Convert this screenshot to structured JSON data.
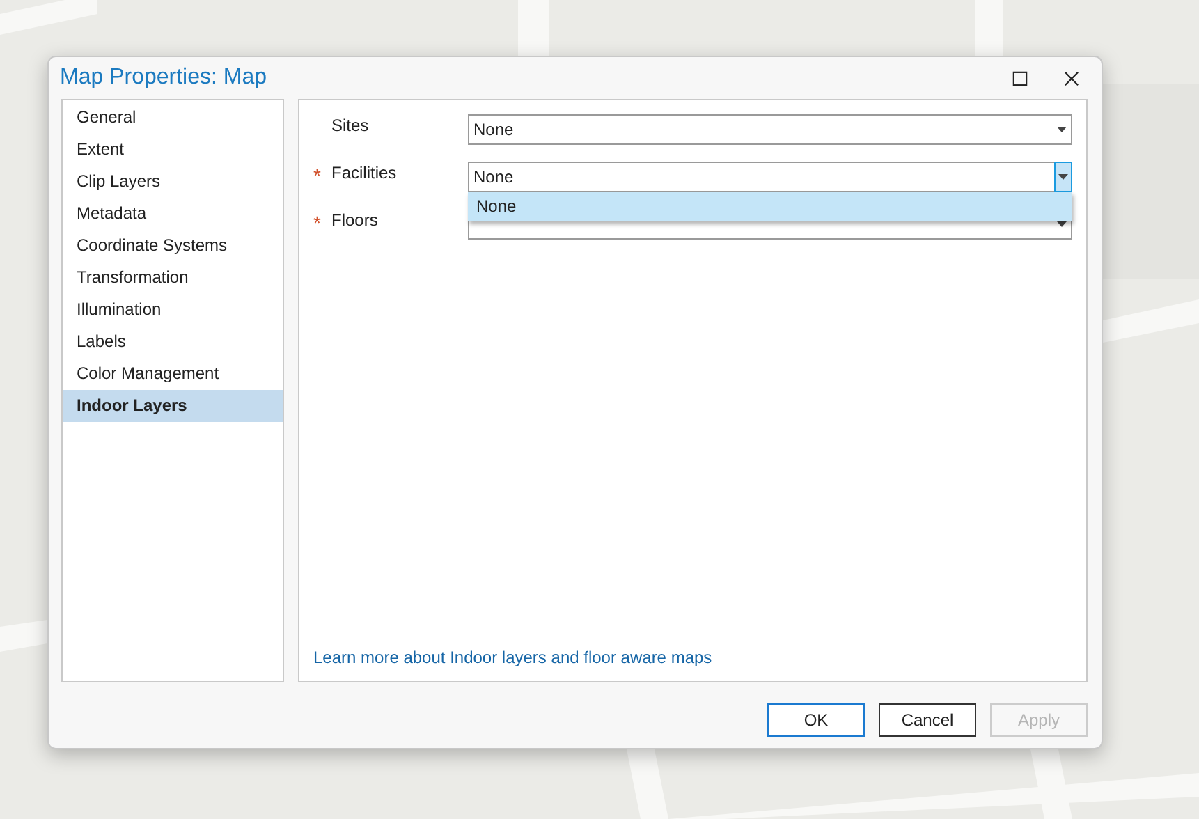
{
  "window": {
    "title": "Map Properties: Map"
  },
  "sidebar": {
    "items": [
      {
        "label": "General",
        "selected": false
      },
      {
        "label": "Extent",
        "selected": false
      },
      {
        "label": "Clip Layers",
        "selected": false
      },
      {
        "label": "Metadata",
        "selected": false
      },
      {
        "label": "Coordinate Systems",
        "selected": false
      },
      {
        "label": "Transformation",
        "selected": false
      },
      {
        "label": "Illumination",
        "selected": false
      },
      {
        "label": "Labels",
        "selected": false
      },
      {
        "label": "Color Management",
        "selected": false
      },
      {
        "label": "Indoor Layers",
        "selected": true
      }
    ]
  },
  "fields": [
    {
      "label": "Sites",
      "value": "None",
      "open": false
    },
    {
      "mark": "*",
      "label": "Facilities",
      "value": "None",
      "open": true,
      "options": [
        {
          "label": "None",
          "selected": true
        }
      ]
    },
    {
      "mark": "*",
      "label": "Floors",
      "open": false
    }
  ],
  "link": "Learn more about Indoor layers and floor aware maps",
  "buttons": [
    {
      "label": "OK",
      "kind": "default",
      "disabled": false
    },
    {
      "label": "Cancel",
      "kind": "normal",
      "disabled": false
    },
    {
      "label": "Apply",
      "kind": "normal",
      "disabled": true
    }
  ]
}
